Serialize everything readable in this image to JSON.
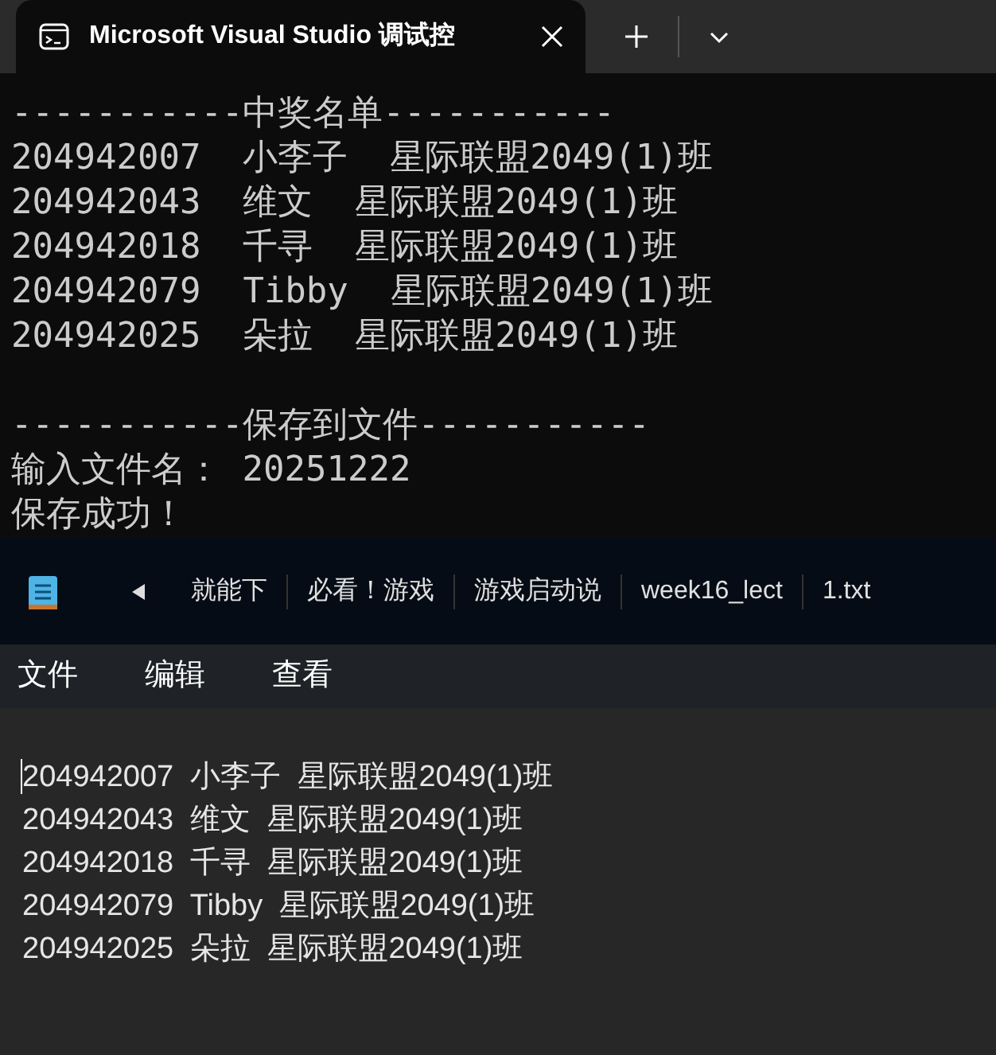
{
  "terminal": {
    "tab": {
      "title": "Microsoft Visual Studio 调试控"
    },
    "blocks": [
      [
        "-----------中奖名单-----------",
        "204942007  小李子  星际联盟2049(1)班",
        "204942043  维文  星际联盟2049(1)班",
        "204942018  千寻  星际联盟2049(1)班",
        "204942079  Tibby  星际联盟2049(1)班",
        "204942025  朵拉  星际联盟2049(1)班"
      ],
      [
        "-----------保存到文件-----------",
        "输入文件名： 20251222",
        "保存成功！"
      ]
    ]
  },
  "notepad": {
    "tabs": [
      "就能下",
      "必看！游戏",
      "游戏启动说",
      "week16_lect",
      "1.txt"
    ],
    "menu": [
      "文件",
      "编辑",
      "查看"
    ],
    "lines": [
      "204942007  小李子  星际联盟2049(1)班",
      "204942043  维文  星际联盟2049(1)班",
      "204942018  千寻  星际联盟2049(1)班",
      "204942079  Tibby  星际联盟2049(1)班",
      "204942025  朵拉  星际联盟2049(1)班"
    ]
  }
}
